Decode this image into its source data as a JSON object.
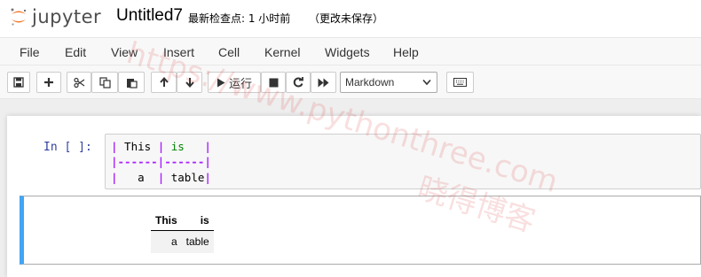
{
  "header": {
    "logo_text": "jupyter",
    "notebook_title": "Untitled7",
    "checkpoint": "最新检查点: 1 小时前",
    "autosave": "（更改未保存）"
  },
  "menubar": {
    "items": [
      "File",
      "Edit",
      "View",
      "Insert",
      "Cell",
      "Kernel",
      "Widgets",
      "Help"
    ]
  },
  "toolbar": {
    "run_label": "运行",
    "cell_type": "Markdown",
    "icons": [
      "save-icon",
      "plus-icon",
      "cut-icon",
      "copy-icon",
      "paste-icon",
      "arrow-up-icon",
      "arrow-down-icon",
      "play-icon",
      "stop-icon",
      "restart-icon",
      "fast-forward-icon",
      "keyboard-icon"
    ]
  },
  "code_cell": {
    "prompt": "In  [  ]:",
    "lines": [
      {
        "bar1": "|",
        "c1": " This ",
        "bar2": "|",
        "c2": " is   ",
        "bar3": "|"
      },
      {
        "text": "|------|------|"
      },
      {
        "bar1": "|",
        "c1": "   a  ",
        "bar2": "|",
        "c2": " table",
        "bar3": "|"
      }
    ]
  },
  "markdown_cell": {
    "table": {
      "headers": [
        "This",
        "is"
      ],
      "rows": [
        [
          "a",
          "table"
        ]
      ]
    }
  },
  "watermark": {
    "text1": "https://www.pythonthree.com",
    "text2": "晓得博客"
  }
}
